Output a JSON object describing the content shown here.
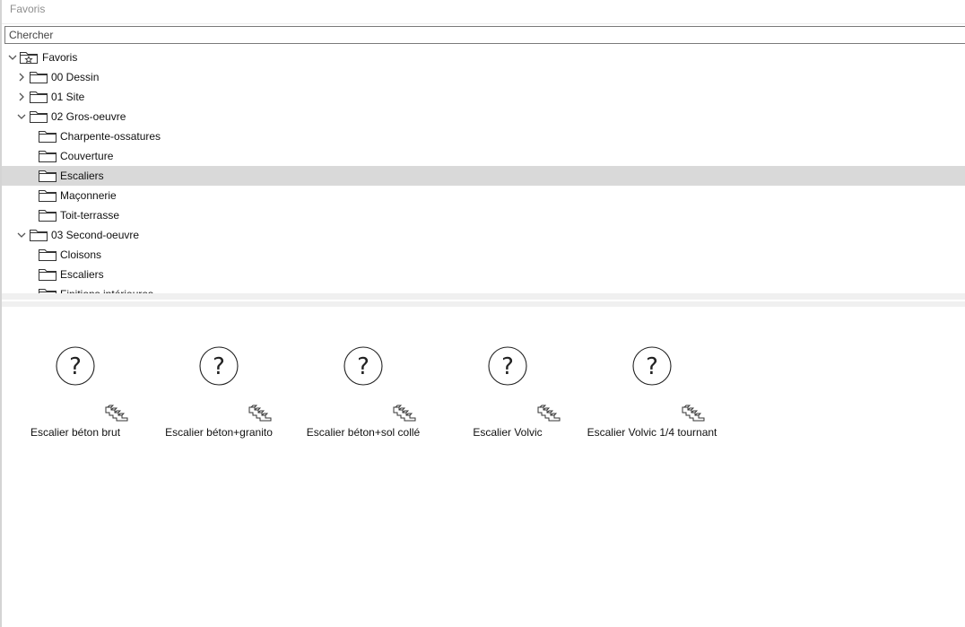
{
  "header": {
    "title": "Favoris"
  },
  "search": {
    "placeholder": "Chercher"
  },
  "tree": {
    "rows": [
      {
        "label": "Favoris",
        "chevron": "down",
        "icon": "star-folder-icon",
        "level": 0
      },
      {
        "label": "00 Dessin",
        "chevron": "right",
        "icon": "folder-icon",
        "level": 1
      },
      {
        "label": "01 Site",
        "chevron": "right",
        "icon": "folder-icon",
        "level": 1
      },
      {
        "label": "02 Gros-oeuvre",
        "chevron": "down",
        "icon": "folder-icon",
        "level": 1
      },
      {
        "label": "Charpente-ossatures",
        "chevron": "none",
        "icon": "folder-icon",
        "level": 2
      },
      {
        "label": "Couverture",
        "chevron": "none",
        "icon": "folder-icon",
        "level": 2
      },
      {
        "label": "Escaliers",
        "chevron": "none",
        "icon": "folder-icon",
        "level": 2,
        "selected": true
      },
      {
        "label": "Maçonnerie",
        "chevron": "none",
        "icon": "folder-icon",
        "level": 2
      },
      {
        "label": "Toit-terrasse",
        "chevron": "none",
        "icon": "folder-icon",
        "level": 2
      },
      {
        "label": "03 Second-oeuvre",
        "chevron": "down",
        "icon": "folder-icon",
        "level": 1
      },
      {
        "label": "Cloisons",
        "chevron": "none",
        "icon": "folder-icon",
        "level": 2
      },
      {
        "label": "Escaliers",
        "chevron": "none",
        "icon": "folder-icon",
        "level": 2
      },
      {
        "label": "Finitions intérieures",
        "chevron": "none",
        "icon": "folder-icon",
        "level": 2
      }
    ]
  },
  "library": {
    "items": [
      {
        "label": "Escalier béton brut",
        "icon": "unknown-preview-icon",
        "badge": "stair-icon"
      },
      {
        "label": "Escalier béton+granito",
        "icon": "unknown-preview-icon",
        "badge": "stair-icon"
      },
      {
        "label": "Escalier béton+sol collé",
        "icon": "unknown-preview-icon",
        "badge": "stair-icon"
      },
      {
        "label": "Escalier Volvic",
        "icon": "unknown-preview-icon",
        "badge": "stair-icon"
      },
      {
        "label": "Escalier Volvic 1/4 tournant",
        "icon": "unknown-preview-icon",
        "badge": "stair-icon"
      }
    ]
  },
  "colors": {
    "selection": "#d9d9d9",
    "header_text": "#8e8e8e",
    "border": "#7a7a7a"
  }
}
